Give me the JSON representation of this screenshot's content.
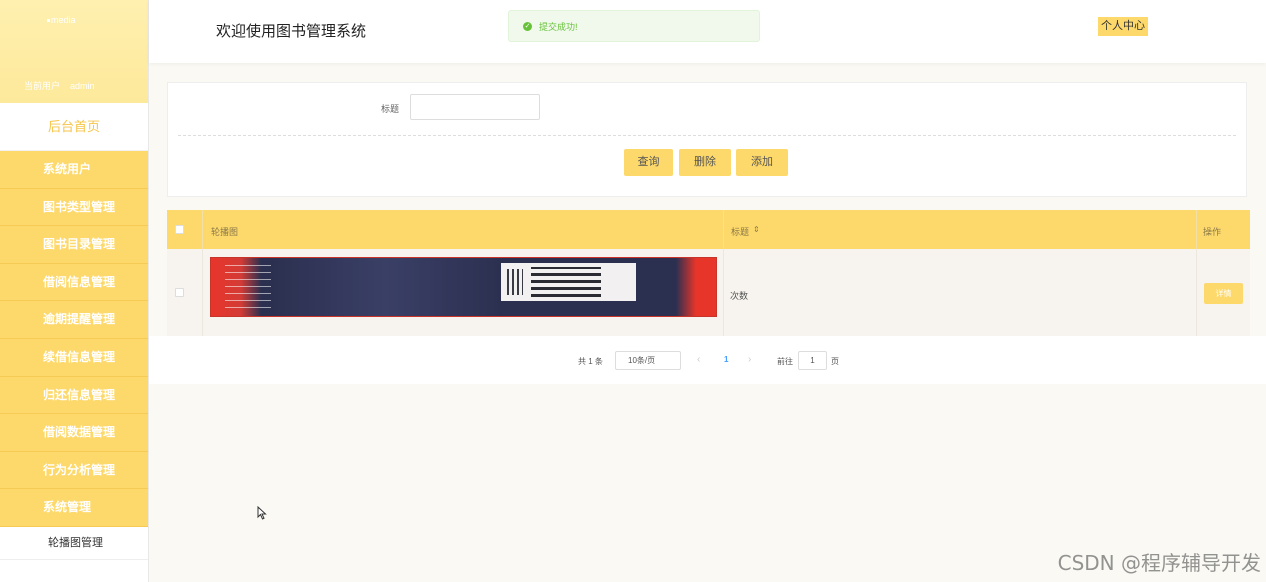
{
  "sidebar": {
    "logo_text": "media",
    "user_label": "当前用户",
    "user_name": "admin",
    "home_label": "后台首页",
    "items": [
      {
        "label": "系统用户"
      },
      {
        "label": "图书类型管理"
      },
      {
        "label": "图书目录管理"
      },
      {
        "label": "借阅信息管理"
      },
      {
        "label": "逾期提醒管理"
      },
      {
        "label": "续借信息管理"
      },
      {
        "label": "归还信息管理"
      },
      {
        "label": "借阅数据管理"
      },
      {
        "label": "行为分析管理"
      },
      {
        "label": "系统管理"
      }
    ],
    "submenu": {
      "label": "轮播图管理"
    }
  },
  "header": {
    "title": "欢迎使用图书管理系统",
    "toast_message": "提交成功!",
    "profile_label": "个人中心"
  },
  "search": {
    "title_label": "标题",
    "title_value": "",
    "query_label": "查询",
    "delete_label": "删除",
    "add_label": "添加"
  },
  "table": {
    "columns": [
      "轮播图",
      "标题",
      "操作"
    ],
    "sort_icon": "⇕",
    "rows": [
      {
        "title": "次数",
        "action_label": "详情"
      }
    ]
  },
  "pagination": {
    "total_text": "共 1 条",
    "page_size": "10条/页",
    "prev_icon": "‹",
    "current_page": "1",
    "next_icon": "›",
    "goto_label": "前往",
    "goto_value": "1",
    "page_suffix": "页"
  },
  "watermark": "CSDN @程序辅导开发",
  "colors": {
    "accent": "#fdd86a",
    "success": "#67c23a",
    "link": "#409eff"
  }
}
